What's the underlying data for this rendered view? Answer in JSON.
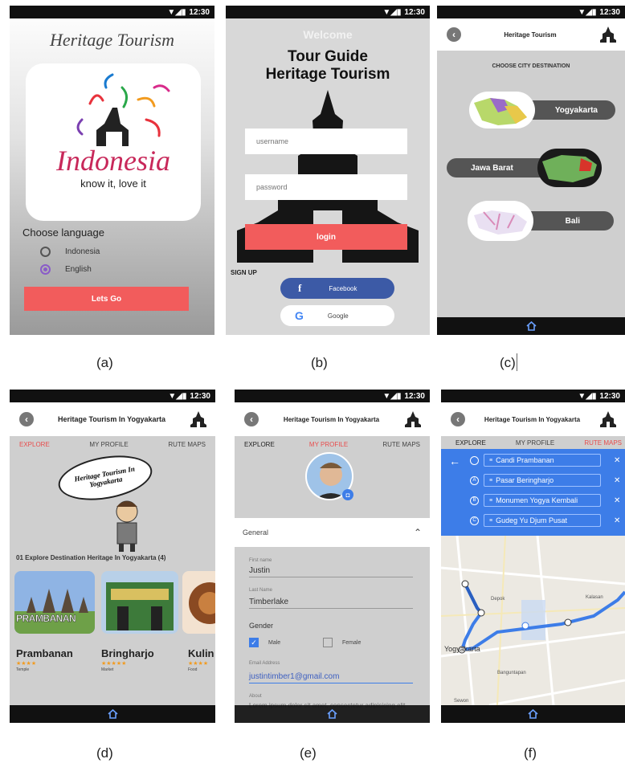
{
  "status": {
    "time": "12:30"
  },
  "captions": [
    "(a)",
    "(b)",
    "(c)",
    "(d)",
    "(e)",
    "(f)"
  ],
  "screen_a": {
    "title": "Heritage Tourism",
    "logo_word": "Indonesia",
    "logo_tagline": "know it, love it",
    "choose_language": "Choose language",
    "languages": [
      {
        "label": "Indonesia",
        "selected": false
      },
      {
        "label": "English",
        "selected": true
      }
    ],
    "button": "Lets Go"
  },
  "screen_b": {
    "welcome": "Welcome",
    "heading_line1": "Tour Guide",
    "heading_line2": "Heritage Tourism",
    "username_placeholder": "username",
    "password_placeholder": "password",
    "login": "login",
    "signup": "SIGN UP",
    "facebook": "Facebook",
    "google": "Google"
  },
  "screen_c": {
    "title": "Heritage Tourism",
    "subtitle": "CHOOSE CITY DESTINATION",
    "cities": [
      "Yogyakarta",
      "Jawa Barat",
      "Bali"
    ]
  },
  "screen_d": {
    "title": "Heritage Tourism In Yogyakarta",
    "tabs": [
      "EXPLORE",
      "MY PROFILE",
      "RUTE MAPS"
    ],
    "bubble": "Heritage Tourism In Yogyakarta",
    "section": "01 Explore Destination Heritage In Yogyakarta (4)",
    "cards": [
      {
        "name": "Prambanan",
        "category": "Temple",
        "sign": "PRAMBANAN"
      },
      {
        "name": "Bringharjo",
        "category": "Market"
      },
      {
        "name": "Kulin",
        "category": "Food"
      }
    ]
  },
  "screen_e": {
    "title": "Heritage Tourism In Yogyakarta",
    "tabs": [
      "EXPLORE",
      "MY PROFILE",
      "RUTE MAPS"
    ],
    "general": "General",
    "first_name_label": "First name",
    "first_name": "Justin",
    "last_name_label": "Last Name",
    "last_name": "Timberlake",
    "gender_label": "Gender",
    "male": "Male",
    "female": "Female",
    "email_label": "Email Address",
    "email": "justintimber1@gmail.com",
    "about_label": "About",
    "about": "Lorem ipsum dolor sit amet, consectetur adipisicing elit"
  },
  "screen_f": {
    "title": "Heritage Tourism In Yogyakarta",
    "tabs": [
      "EXPLORE",
      "MY PROFILE",
      "RUTE MAPS"
    ],
    "route": [
      {
        "marker": "",
        "label": "Candi Prambanan"
      },
      {
        "marker": "A",
        "label": "Pasar Beringharjo"
      },
      {
        "marker": "B",
        "label": "Monumen Yogya Kembali"
      },
      {
        "marker": "C",
        "label": "Gudeg Yu Djum Pusat"
      }
    ],
    "map_labels": [
      "Depok",
      "Kalasan",
      "Yogyakarta",
      "Banguntapan",
      "Sewon"
    ]
  },
  "colors": {
    "accent": "#f25c5c",
    "map_blue": "#3d7de8",
    "facebook": "#3c5aa6"
  }
}
